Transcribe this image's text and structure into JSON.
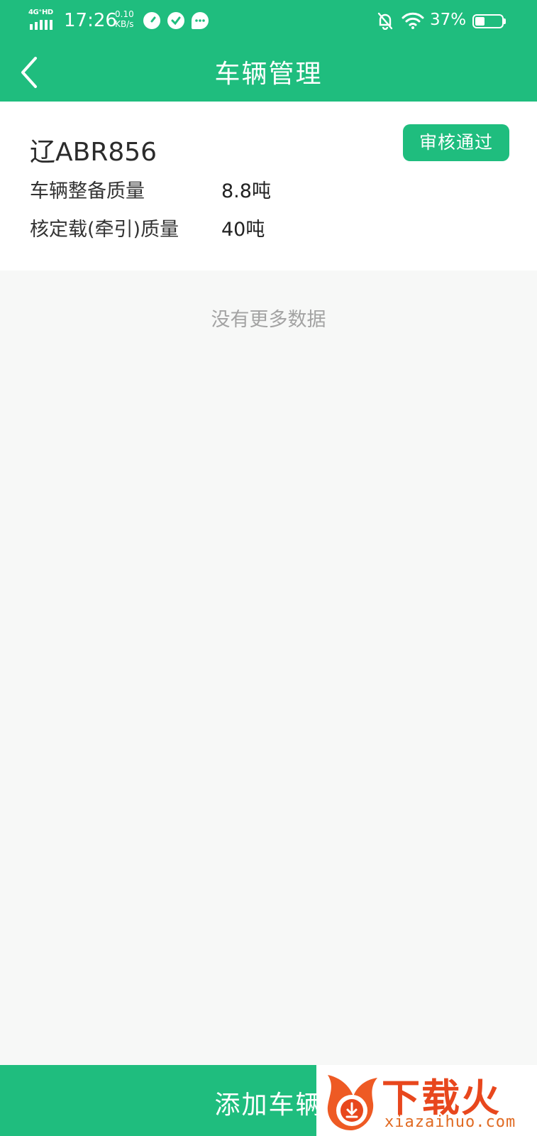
{
  "status_bar": {
    "network": "4G⁺HD",
    "time": "17:26",
    "speed_value": "0.10",
    "speed_unit": "KB/s",
    "battery_percent": "37%",
    "battery_level": 0.37
  },
  "header": {
    "title": "车辆管理"
  },
  "vehicle": {
    "plate": "辽ABR856",
    "status_badge": "审核通过",
    "curb_weight_label": "车辆整备质量",
    "curb_weight_value": "8.8吨",
    "rated_load_label": "核定载(牵引)质量",
    "rated_load_value": "40吨"
  },
  "list": {
    "no_more_text": "没有更多数据"
  },
  "footer": {
    "add_button_label": "添加车辆"
  },
  "watermark": {
    "title": "下载火",
    "url": "xiazaihuo.com"
  },
  "colors": {
    "primary_green": "#1fbd7e",
    "background": "#f7f8f7",
    "watermark_orange": "#e8471d"
  }
}
